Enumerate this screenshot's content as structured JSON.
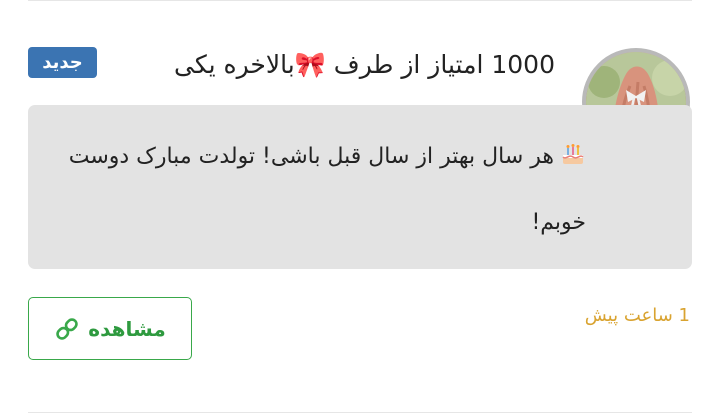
{
  "notification": {
    "title": "1000 امتیاز از طرف 🎀بالاخره یکی",
    "badge": "جدید",
    "message": {
      "emoji": "🎂",
      "text": "هر سال بهتر از سال قبل باشی! تولدت مبارک دوست خوبم!"
    },
    "timestamp": "1 ساعت پیش",
    "view_button_label": "مشاهده",
    "icons": {
      "avatar": "avatar-photo",
      "message": "birthday-cake-icon",
      "view": "link-icon"
    },
    "colors": {
      "badge_background": "#3b74b2",
      "message_background": "#e3e3e3",
      "timestamp": "#d9a330",
      "button_accent": "#39a84a"
    }
  }
}
